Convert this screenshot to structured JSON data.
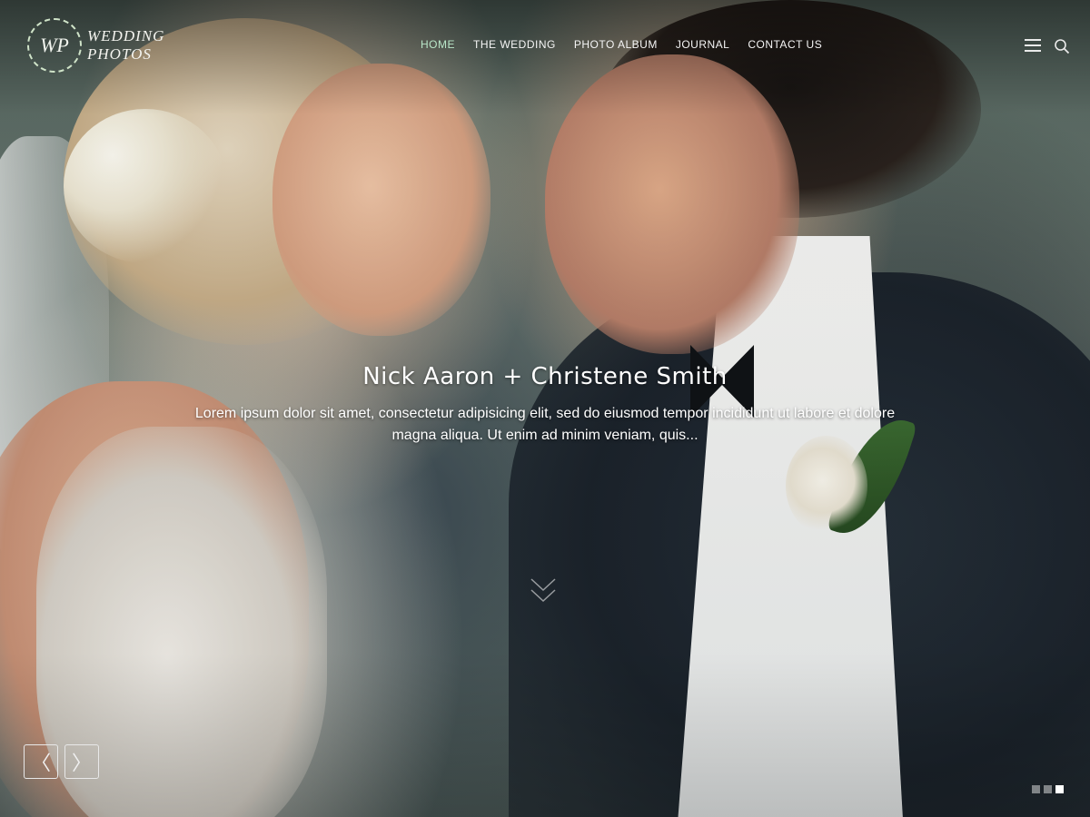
{
  "logo": {
    "monogram": "WP",
    "line1": "WEDDING",
    "line2": "PHOTOS"
  },
  "nav": {
    "items": [
      {
        "label": "HOME",
        "active": true
      },
      {
        "label": "THE WEDDING",
        "active": false
      },
      {
        "label": "PHOTO ALBUM",
        "active": false
      },
      {
        "label": "JOURNAL",
        "active": false
      },
      {
        "label": "CONTACT US",
        "active": false
      }
    ]
  },
  "header_icons": [
    "menu-icon",
    "search-icon"
  ],
  "hero": {
    "title": "Nick Aaron + Christene Smith",
    "text": "Lorem ipsum dolor sit amet, consectetur adipisicing elit, sed do eiusmod tempor incididunt ut labore et dolore magna aliqua. Ut enim ad minim veniam, quis..."
  },
  "slider": {
    "prev_icon": "chevron-left-icon",
    "next_icon": "chevron-right-icon",
    "prev_glyph": "〈",
    "next_glyph": "〉",
    "slide_count": 3,
    "active_slide": 3
  },
  "colors": {
    "active_nav": "#b9e6c8",
    "text": "#ffffff"
  }
}
